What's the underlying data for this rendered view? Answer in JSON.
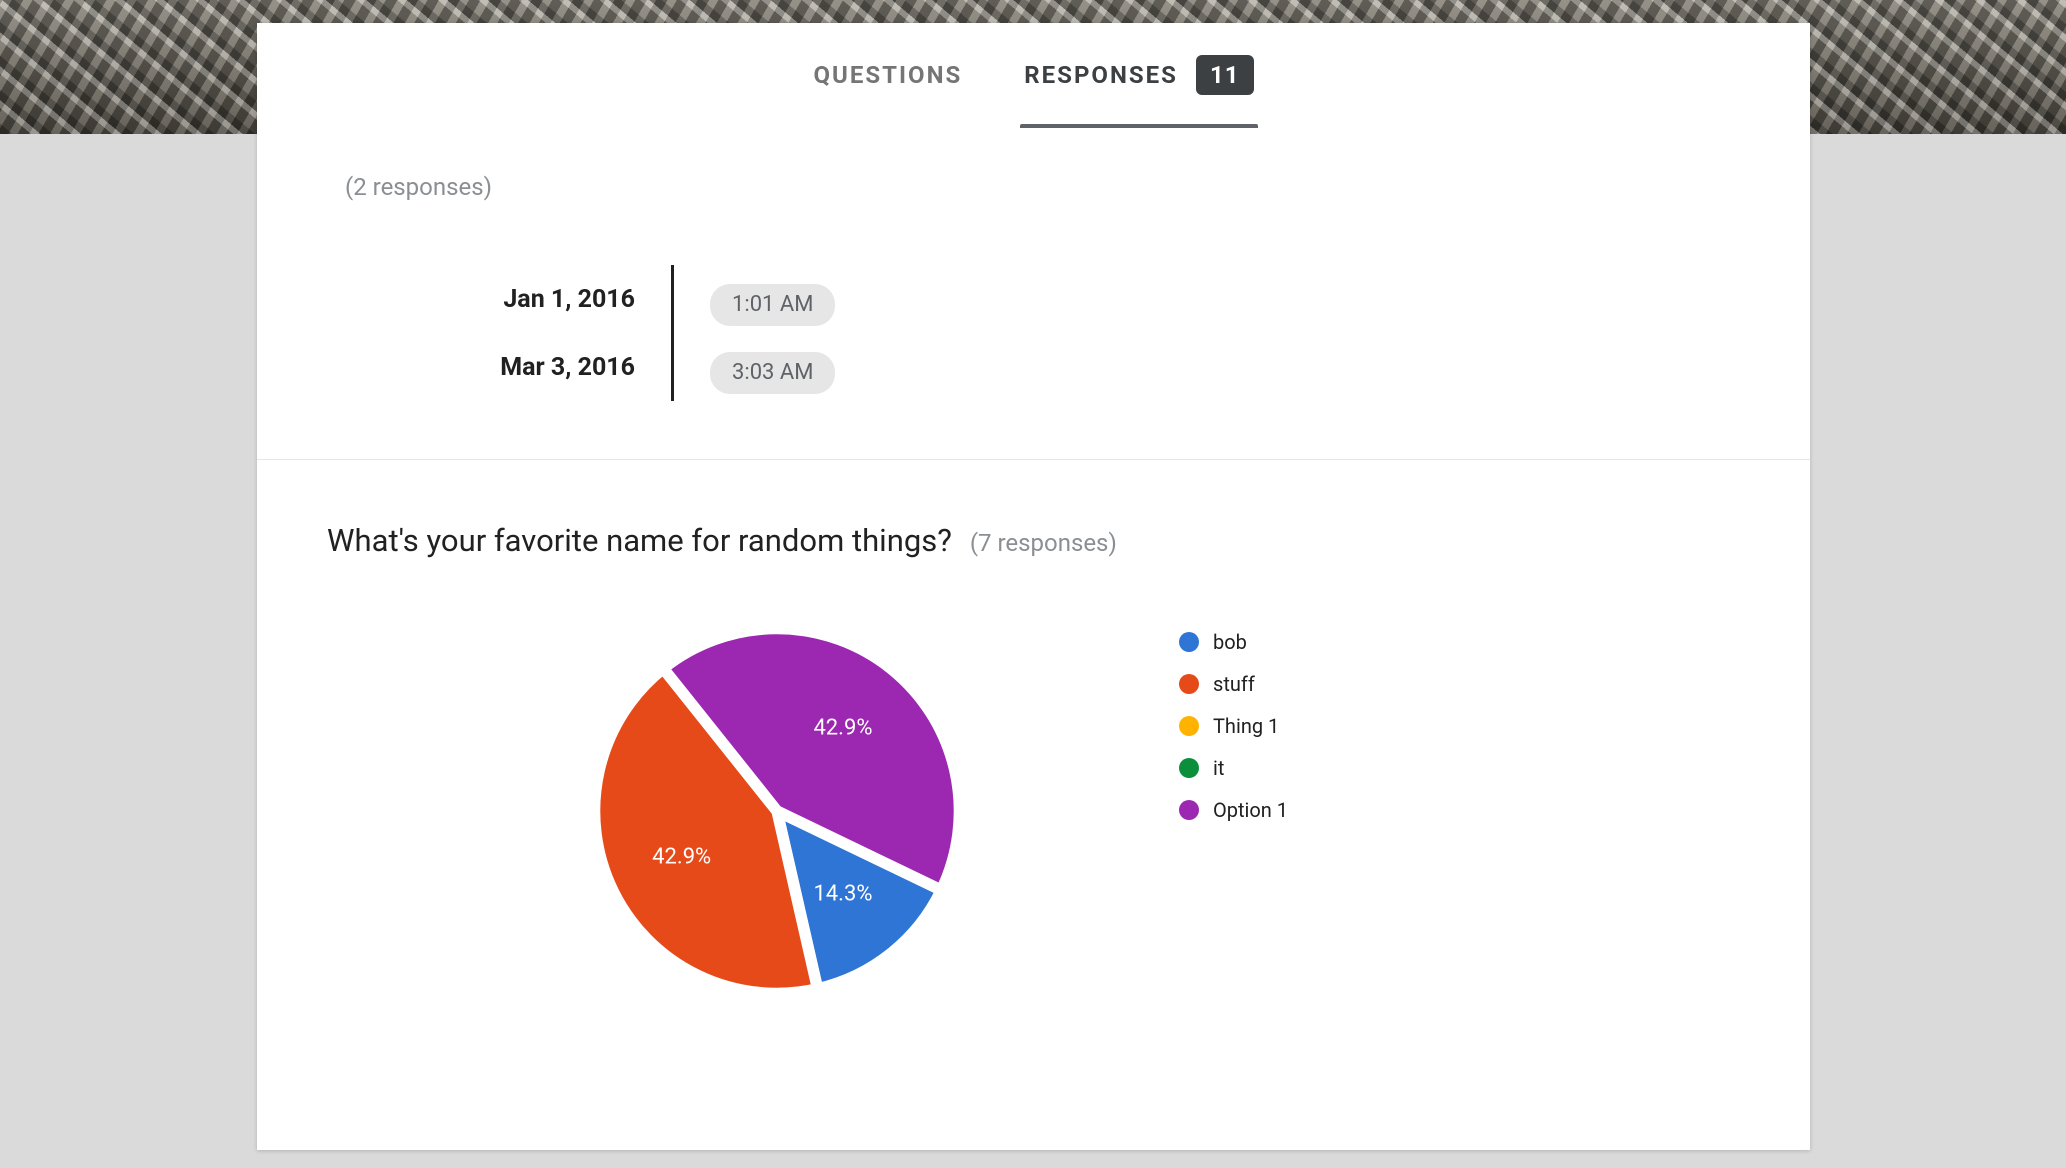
{
  "tabs": {
    "questions_label": "QUESTIONS",
    "responses_label": "RESPONSES",
    "responses_count": "11",
    "active": "responses"
  },
  "section1": {
    "count_text": "(2 responses)",
    "rows": [
      {
        "date": "Jan 1, 2016",
        "time": "1:01 AM"
      },
      {
        "date": "Mar 3, 2016",
        "time": "3:03 AM"
      }
    ]
  },
  "section2": {
    "question": "What's your favorite name for random things?",
    "count_text": "(7 responses)"
  },
  "chart_data": {
    "type": "pie",
    "title": "What's your favorite name for random things?",
    "series": [
      {
        "name": "bob",
        "value": 1,
        "percent": 14.3,
        "color": "#2e75d6",
        "label": "14.3%"
      },
      {
        "name": "stuff",
        "value": 3,
        "percent": 42.9,
        "color": "#e64a19",
        "label": "42.9%"
      },
      {
        "name": "Thing 1",
        "value": 0,
        "percent": 0.0,
        "color": "#ffb300",
        "label": ""
      },
      {
        "name": "it",
        "value": 0,
        "percent": 0.0,
        "color": "#0b8f3a",
        "label": ""
      },
      {
        "name": "Option 1",
        "value": 3,
        "percent": 42.9,
        "color": "#9c27b0",
        "label": "42.9%"
      }
    ],
    "legend_order": [
      "bob",
      "stuff",
      "Thing 1",
      "it",
      "Option 1"
    ],
    "total_responses": 7
  }
}
